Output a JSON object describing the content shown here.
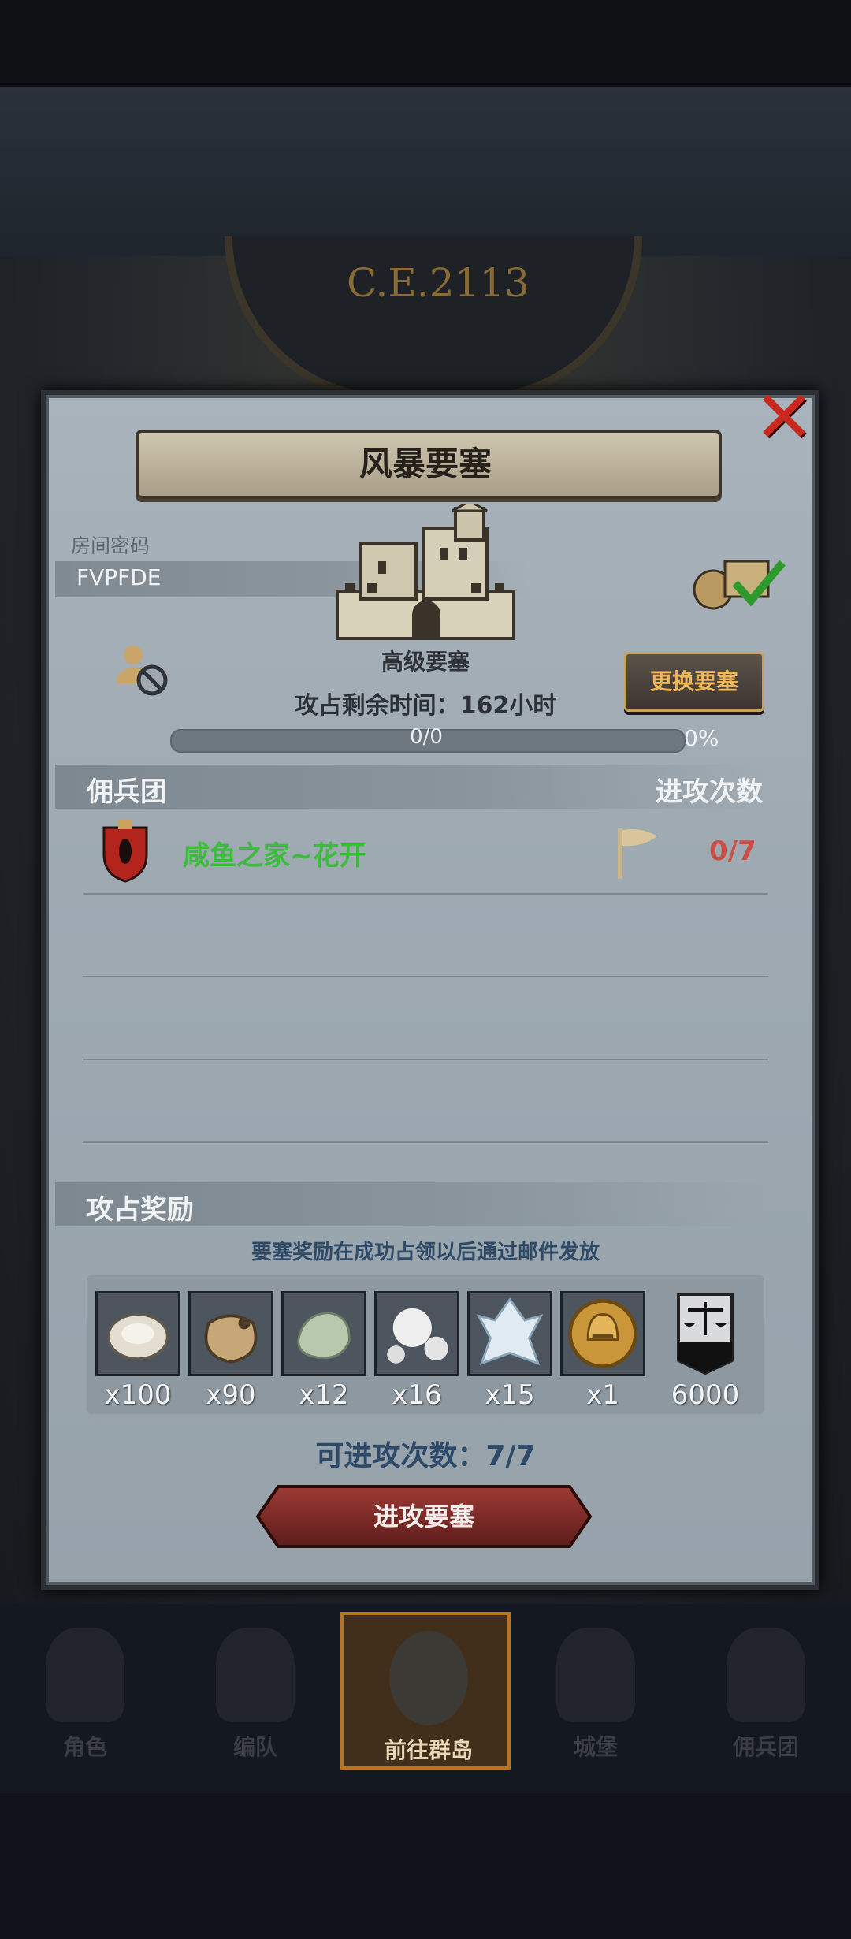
{
  "background": {
    "year_text": "C.E.2113"
  },
  "dialog": {
    "title": "风暴要塞",
    "room_password_label": "房间密码",
    "room_password_value": "FVPFDE",
    "fortress_type": "高级要塞",
    "change_button": "更换要塞",
    "time_left_text": "攻占剩余时间：162小时",
    "progress": {
      "text": "0/0",
      "percent_text": "0%",
      "value": 0
    },
    "mercenary_header": "佣兵团",
    "attack_count_header": "进攻次数",
    "guild": {
      "name": "咸鱼之家~花开",
      "attacks": "0/7"
    },
    "reward_header": "攻占奖励",
    "reward_note": "要塞奖励在成功占领以后通过邮件发放",
    "rewards": [
      {
        "icon": "oyster-icon",
        "count": "x100"
      },
      {
        "icon": "pouch-icon",
        "count": "x90"
      },
      {
        "icon": "jade-stone-icon",
        "count": "x12"
      },
      {
        "icon": "pearls-icon",
        "count": "x16"
      },
      {
        "icon": "crystal-icon",
        "count": "x15"
      },
      {
        "icon": "gold-helmet-coin-icon",
        "count": "x1"
      },
      {
        "icon": "scales-banner-icon",
        "count": "6000"
      }
    ],
    "available_attacks": "可进攻次数：7/7",
    "attack_button": "进攻要塞"
  },
  "bottom_nav": [
    {
      "label": "角色",
      "icon": "knight-icon",
      "active": false
    },
    {
      "label": "编队",
      "icon": "formation-icon",
      "active": false
    },
    {
      "label": "前往群岛",
      "icon": "islands-icon",
      "active": true
    },
    {
      "label": "城堡",
      "icon": "castle-icon",
      "active": false
    },
    {
      "label": "佣兵团",
      "icon": "mercenary-icon",
      "active": false
    }
  ],
  "colors": {
    "guild_name": "#3cbb3c",
    "attack_count": "#c85046",
    "accent_gold": "#f0b65a",
    "close_red": "#c8281e"
  }
}
